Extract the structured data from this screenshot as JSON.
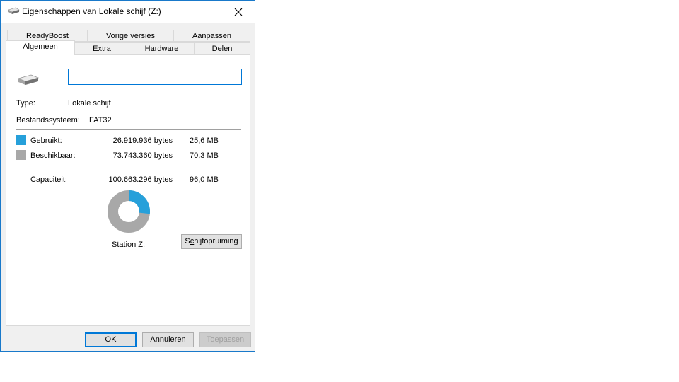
{
  "window": {
    "title": "Eigenschappen van Lokale schijf (Z:)",
    "close_icon": "close-icon",
    "accent_color": "#1979ca"
  },
  "tabs_row1": [
    {
      "label": "ReadyBoost"
    },
    {
      "label": "Vorige versies"
    },
    {
      "label": "Aanpassen"
    }
  ],
  "tabs_row2": [
    {
      "label": "Algemeen",
      "active": true
    },
    {
      "label": "Extra"
    },
    {
      "label": "Hardware"
    },
    {
      "label": "Delen"
    }
  ],
  "general": {
    "drive_icon": "drive-icon",
    "name_value": "",
    "type_label": "Type:",
    "type_value": "Lokale schijf",
    "fs_label": "Bestandssysteem:",
    "fs_value": "FAT32",
    "used": {
      "label": "Gebruikt:",
      "bytes": "26.919.936 bytes",
      "size": "25,6 MB",
      "color": "#26a0da"
    },
    "free": {
      "label": "Beschikbaar:",
      "bytes": "73.743.360 bytes",
      "size": "70,3 MB",
      "color": "#a8a8a8"
    },
    "capacity": {
      "label": "Capaciteit:",
      "bytes": "100.663.296 bytes",
      "size": "96,0 MB"
    },
    "used_fraction": 0.2674,
    "station_label": "Station Z:",
    "cleanup_button": {
      "pre": "S",
      "mid": "c",
      "post": "hijfopruiming"
    }
  },
  "buttons": {
    "ok": "OK",
    "cancel": "Annuleren",
    "apply": "Toepassen"
  }
}
